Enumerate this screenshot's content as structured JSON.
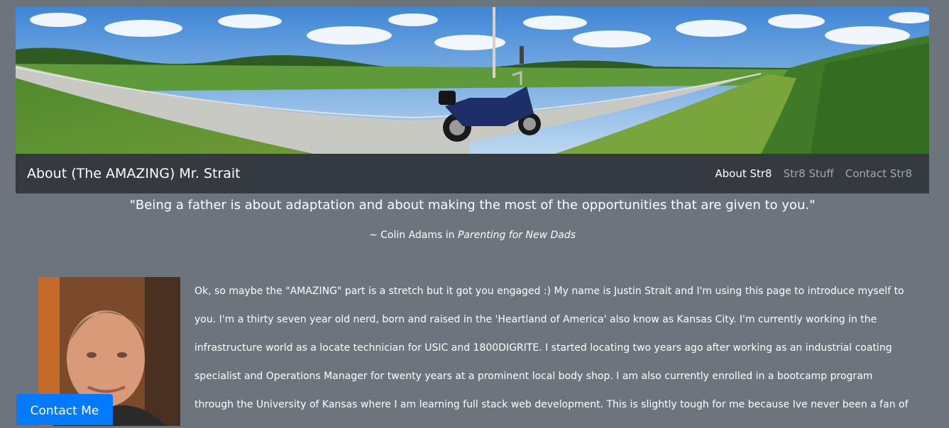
{
  "navbar": {
    "brand": "About (The AMAZING) Mr. Strait",
    "links": [
      {
        "label": "About Str8"
      },
      {
        "label": "Str8 Stuff"
      },
      {
        "label": "Contact Str8"
      }
    ]
  },
  "quote": {
    "text": "\"Being a father is about adaptation and about making the most of the opportunities that are given to you.\"",
    "attribution_prefix": "~ Colin Adams in ",
    "attribution_source": "Parenting for New Dads"
  },
  "bio": {
    "text": "Ok, so maybe the \"AMAZING\" part is a stretch but it got you engaged :) My name is Justin Strait and I'm using this page to introduce myself to you. I'm a thirty seven year old nerd, born and raised in the 'Heartland of America' also know as Kansas City. I'm currently working in the infrastructure world as a locate technician for USIC and 1800DIGRITE. I started locating two years ago after working as an industrial coating specialist and Operations Manager for twenty years at a prominent local body shop. I am also currently enrolled in a bootcamp program through the University of Kansas where I am learning full stack web development. This is slightly tough for me because Ive never been a fan of"
  },
  "contact_button": {
    "label": "Contact Me"
  },
  "colors": {
    "page_background": "#6c757d",
    "navbar_background": "#343a40",
    "button_primary": "#007bff"
  }
}
